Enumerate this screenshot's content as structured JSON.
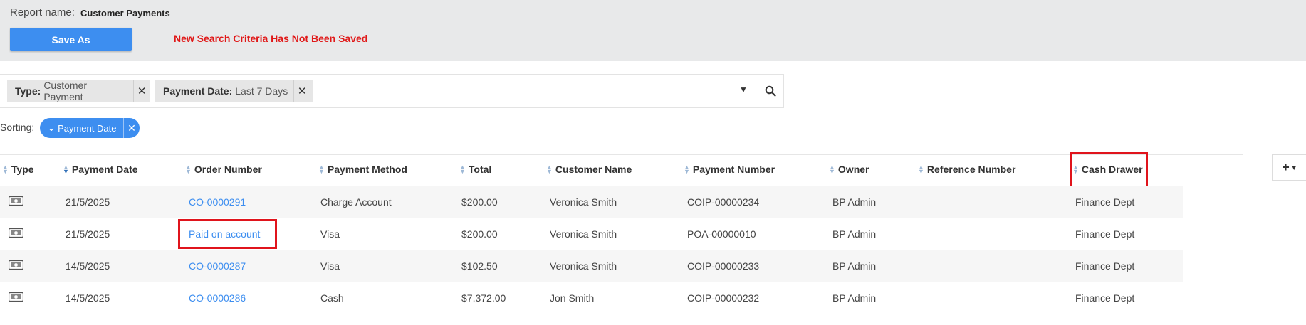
{
  "report": {
    "label": "Report name:",
    "name": "Customer Payments",
    "save_as": "Save As",
    "unsaved_warning": "New Search Criteria Has Not Been Saved"
  },
  "filters": [
    {
      "key": "Type:",
      "value": "Customer Payment"
    },
    {
      "key": "Payment Date:",
      "value": "Last 7 Days"
    }
  ],
  "sorting": {
    "label": "Sorting:",
    "pill": "Payment Date"
  },
  "table": {
    "columns": [
      "Type",
      "Payment Date",
      "Order Number",
      "Payment Method",
      "Total",
      "Customer Name",
      "Payment Number",
      "Owner",
      "Reference Number",
      "Cash Drawer"
    ],
    "rows": [
      {
        "payment_date": "21/5/2025",
        "order_number": "CO-0000291",
        "payment_method": "Charge Account",
        "total": "$200.00",
        "customer_name": "Veronica Smith",
        "payment_number": "COIP-00000234",
        "owner": "BP Admin",
        "reference_number": "",
        "cash_drawer": "Finance Dept"
      },
      {
        "payment_date": "21/5/2025",
        "order_number": "Paid on account",
        "payment_method": "Visa",
        "total": "$200.00",
        "customer_name": "Veronica Smith",
        "payment_number": "POA-00000010",
        "owner": "BP Admin",
        "reference_number": "",
        "cash_drawer": "Finance Dept"
      },
      {
        "payment_date": "14/5/2025",
        "order_number": "CO-0000287",
        "payment_method": "Visa",
        "total": "$102.50",
        "customer_name": "Veronica Smith",
        "payment_number": "COIP-00000233",
        "owner": "BP Admin",
        "reference_number": "",
        "cash_drawer": "Finance Dept"
      },
      {
        "payment_date": "14/5/2025",
        "order_number": "CO-0000286",
        "payment_method": "Cash",
        "total": "$7,372.00",
        "customer_name": "Jon Smith",
        "payment_number": "COIP-00000232",
        "owner": "BP Admin",
        "reference_number": "",
        "cash_drawer": "Finance Dept"
      }
    ]
  },
  "icons": {
    "type_icon": "cash-icon",
    "search": "search-icon",
    "add_column": "plus-icon"
  },
  "colors": {
    "accent": "#3d8ef0",
    "warning": "#e01818",
    "highlight": "#e0141c"
  }
}
